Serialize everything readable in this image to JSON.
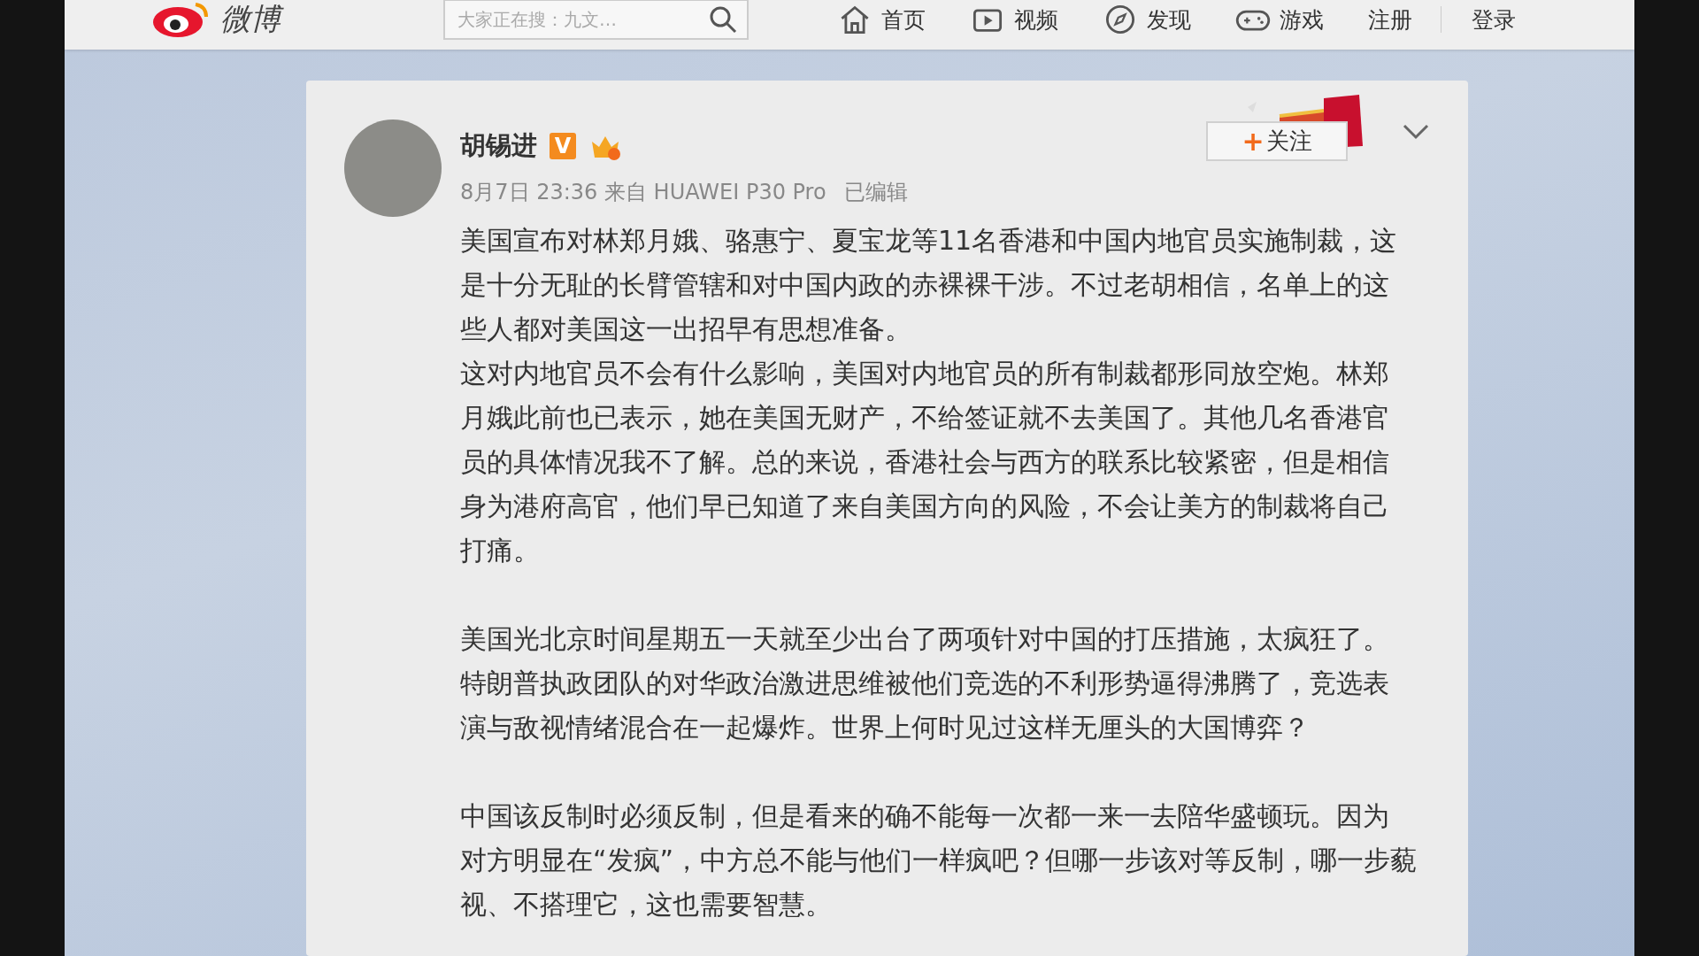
{
  "header": {
    "logo_text": "微博",
    "search": {
      "placeholder": "大家正在搜：九文…"
    },
    "nav": [
      {
        "kind": "home",
        "label": "首页"
      },
      {
        "kind": "video",
        "label": "视频"
      },
      {
        "kind": "discover",
        "label": "发现"
      },
      {
        "kind": "game",
        "label": "游戏"
      },
      {
        "kind": "plain",
        "label": "注册"
      },
      {
        "kind": "plain",
        "label": "登录"
      }
    ]
  },
  "post": {
    "author": "胡锡进",
    "verified_badge": "V",
    "meta": "8月7日 23:36 来自 HUAWEI P30 Pro",
    "edited": "已编辑",
    "follow_button": {
      "plus": "+",
      "label": "关注"
    },
    "sections": [
      {
        "paragraphs": [
          {
            "lines": [
              "美国宣布对林郑月娥、骆惠宁、夏宝龙等11名香港和中国内地官员实施制裁，这",
              "是十分无耻的长臂管辖和对中国内政的赤裸裸干涉。不过老胡相信，名单上的这",
              "些人都对美国这一出招早有思想准备。"
            ]
          },
          {
            "lines": [
              "这对内地官员不会有什么影响，美国对内地官员的所有制裁都形同放空炮。林郑",
              "月娥此前也已表示，她在美国无财产，不给签证就不去美国了。其他几名香港官",
              "员的具体情况我不了解。总的来说，香港社会与西方的联系比较紧密，但是相信",
              "身为港府高官，他们早已知道了来自美国方向的风险，不会让美方的制裁将自己",
              "打痛。"
            ]
          }
        ]
      },
      {
        "paragraphs": [
          {
            "lines": [
              "美国光北京时间星期五一天就至少出台了两项针对中国的打压措施，太疯狂了。",
              "特朗普执政团队的对华政治激进思维被他们竞选的不利形势逼得沸腾了，竞选表",
              "演与敌视情绪混合在一起爆炸。世界上何时见过这样无厘头的大国博弈？"
            ]
          }
        ]
      },
      {
        "paragraphs": [
          {
            "lines": [
              "中国该反制时必须反制，但是看来的确不能每一次都一来一去陪华盛顿玩。因为",
              "对方明显在“发疯”，中方总不能与他们一样疯吧？但哪一步该对等反制，哪一步藐",
              "视、不搭理它，这也需要智慧。"
            ]
          }
        ]
      }
    ]
  }
}
